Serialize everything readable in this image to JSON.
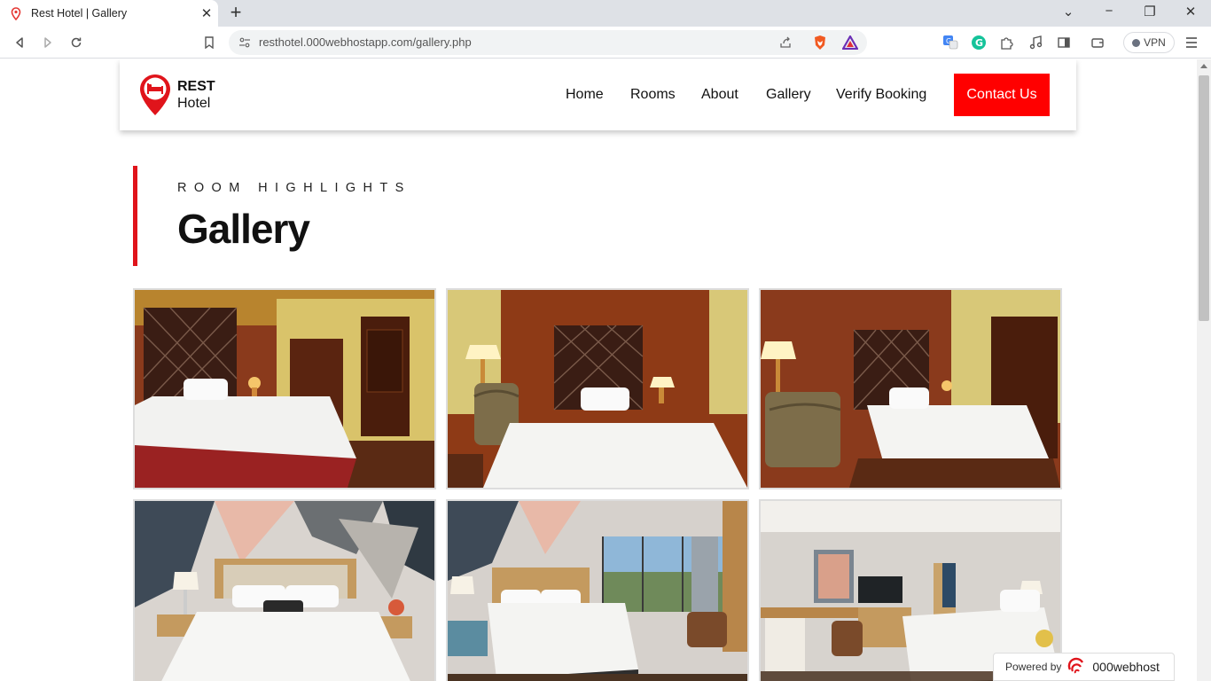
{
  "browser": {
    "tab_title": "Rest Hotel | Gallery",
    "new_tab": "+",
    "tab_close": "✕",
    "url": "resthotel.000webhostapp.com/gallery.php",
    "vpn_label": "VPN"
  },
  "site": {
    "brand_line1": "REST",
    "brand_line2": "Hotel",
    "nav": [
      {
        "label": "Home"
      },
      {
        "label": "Rooms"
      },
      {
        "label": "About"
      },
      {
        "label": "Gallery"
      },
      {
        "label": "Verify Booking"
      }
    ],
    "contact_label": "Contact Us",
    "accent_color": "#ff0000"
  },
  "section": {
    "eyebrow": "ROOM HIGHLIGHTS",
    "title": "Gallery"
  },
  "gallery": {
    "images": [
      {
        "name": "gallery-image-1"
      },
      {
        "name": "gallery-image-2"
      },
      {
        "name": "gallery-image-3"
      },
      {
        "name": "gallery-image-4"
      },
      {
        "name": "gallery-image-5"
      },
      {
        "name": "gallery-image-6"
      }
    ]
  },
  "footer": {
    "powered_by": "Powered by",
    "host_brand": "000webhost"
  },
  "icons": {
    "back": "arrow-left-icon",
    "forward": "arrow-right-icon",
    "reload": "reload-icon",
    "bookmark": "bookmark-icon",
    "site_info": "tune-icon",
    "share": "share-icon",
    "brave": "brave-shield-icon",
    "rewards": "brave-rewards-icon",
    "translate": "translate-icon",
    "grammarly": "grammarly-icon",
    "extensions": "puzzle-icon",
    "media": "music-note-icon",
    "sidebar": "sidebar-icon",
    "wallet": "wallet-icon",
    "menu": "hamburger-menu-icon"
  }
}
